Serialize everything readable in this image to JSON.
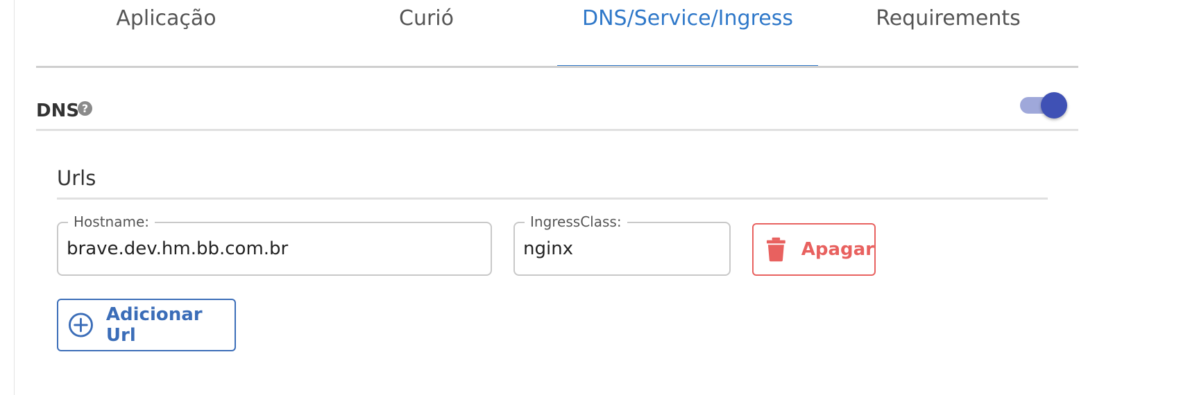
{
  "tabs": [
    {
      "label": "Aplicação",
      "active": false
    },
    {
      "label": "Curió",
      "active": false
    },
    {
      "label": "DNS/Service/Ingress",
      "active": true
    },
    {
      "label": "Requirements",
      "active": false
    }
  ],
  "dns_section": {
    "title": "DNS",
    "help_icon": "question-circle",
    "help_symbol": "?",
    "toggle_on": true
  },
  "urls_section": {
    "title": "Urls",
    "hostname": {
      "label": "Hostname:",
      "value": "brave.dev.hm.bb.com.br"
    },
    "ingress_class": {
      "label": "IngressClass:",
      "value": "nginx"
    },
    "delete_label": "Apagar",
    "add_label": "Adicionar Url"
  },
  "colors": {
    "accent": "#2f78c9",
    "danger": "#e8615f",
    "toggle_knob": "#3f51b5",
    "toggle_track": "#9fa8da"
  }
}
